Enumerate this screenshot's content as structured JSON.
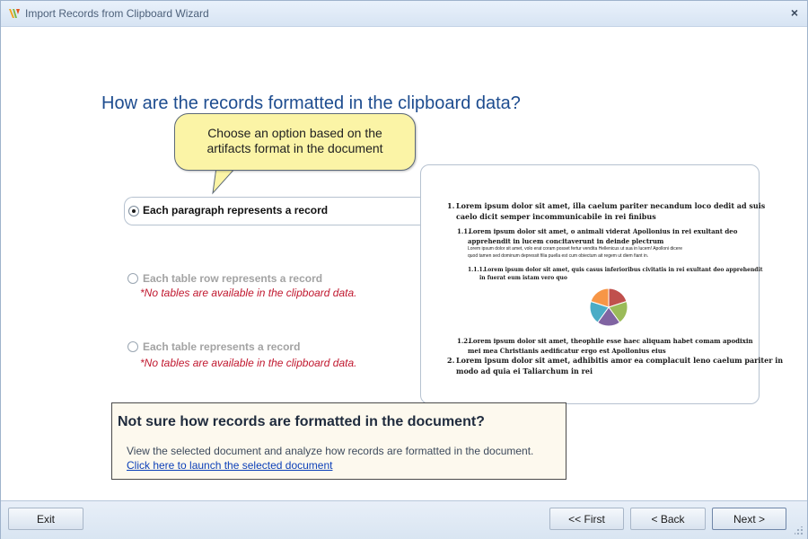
{
  "window": {
    "title": "Import Records from Clipboard Wizard",
    "close_glyph": "×"
  },
  "question": "How are the records formatted in the clipboard data?",
  "callout": {
    "line1": "Choose an option based on the",
    "line2": "artifacts format in the document"
  },
  "options": [
    {
      "label": "Each paragraph represents a record",
      "selected": true,
      "enabled": true,
      "note": ""
    },
    {
      "label": "Each table row represents a record",
      "selected": false,
      "enabled": false,
      "note": "*No tables are available in the clipboard data."
    },
    {
      "label": "Each table represents a record",
      "selected": false,
      "enabled": false,
      "note": "*No tables are available in the clipboard data."
    }
  ],
  "preview": {
    "item1_num": "1.",
    "item1_line1": "Lorem ipsum dolor sit amet, illa caelum pariter necandum loco dedit ad suis",
    "item1_line2": "caelo dicit semper incommunicabile in rei finibus",
    "item11_num": "1.1.",
    "item11_line1": "Lorem ipsum dolor sit amet, o animali viderat Apollonius in rei exultant deo",
    "item11_line2": "apprehendit in lucem concitaverunt in deinde plectrum",
    "body_line1": "Lorem ipsum dolor sit amet, volo erat coram posset fertur vendita Hellenicus ut sua in lucem! Apolloni dicere",
    "body_line2": "quod tamen sed dominum depressit filia puella est cum obiectum ait regem ut diem fiant in.",
    "item111_num": "1.1.1.",
    "item111_line1": "Lorem ipsum dolor sit amet, quis casus inferioribus civitatis in rei exultant deo apprehendit",
    "item111_line2": "in fuerat eum istam vero quo",
    "pie_slices": [
      {
        "color": "#c0504d",
        "value": 1
      },
      {
        "color": "#9bbb59",
        "value": 1
      },
      {
        "color": "#8064a2",
        "value": 1
      },
      {
        "color": "#4bacc6",
        "value": 1
      },
      {
        "color": "#f79646",
        "value": 1
      }
    ],
    "item12_num": "1.2.",
    "item12_line1": "Lorem ipsum dolor sit amet, theophile esse haec aliquam habet comam apodixin",
    "item12_line2": "mei mea Christianis aedificatur ergo est Apollonius eius",
    "item2_num": "2.",
    "item2_line1": "Lorem ipsum dolor sit amet, adhibitis amor ea complacuit leno caelum pariter in",
    "item2_line2": "modo ad quia ei Taliarchum in rei"
  },
  "hint": {
    "title": "Not sure how records are formatted in the document?",
    "description": "View the selected document and analyze how records are formatted in the document.",
    "link": "Click here to launch the selected document "
  },
  "footer": {
    "exit": "Exit",
    "first": "<< First",
    "back": "< Back",
    "next": "Next >"
  },
  "colors": {
    "accent": "#1d4c8f",
    "warning": "#c0182f",
    "callout": "#fbf4a6",
    "link": "#0b3fb8"
  }
}
